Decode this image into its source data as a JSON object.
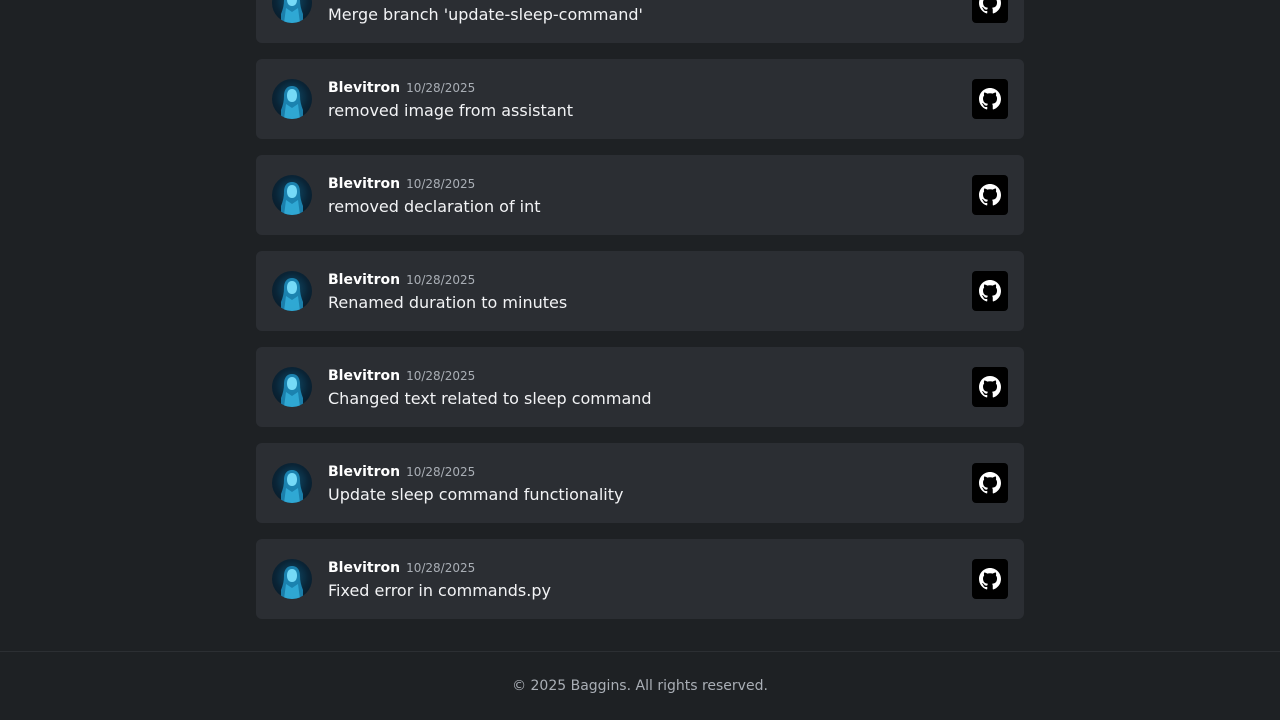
{
  "commits": [
    {
      "author": "",
      "date": "",
      "message": "Merge branch 'update-sleep-command'",
      "link_icon": "github-icon"
    },
    {
      "author": "Blevitron",
      "date": "10/28/2025",
      "message": "removed image from assistant",
      "link_icon": "github-icon"
    },
    {
      "author": "Blevitron",
      "date": "10/28/2025",
      "message": "removed declaration of int",
      "link_icon": "github-icon"
    },
    {
      "author": "Blevitron",
      "date": "10/28/2025",
      "message": "Renamed duration to minutes",
      "link_icon": "github-icon"
    },
    {
      "author": "Blevitron",
      "date": "10/28/2025",
      "message": "Changed text related to sleep command",
      "link_icon": "github-icon"
    },
    {
      "author": "Blevitron",
      "date": "10/28/2025",
      "message": "Update sleep command functionality",
      "link_icon": "github-icon"
    },
    {
      "author": "Blevitron",
      "date": "10/28/2025",
      "message": "Fixed error in commands.py",
      "link_icon": "github-icon"
    }
  ],
  "footer": {
    "text": "© 2025 Baggins. All rights reserved."
  },
  "colors": {
    "background": "#1e2124",
    "card": "#2b2e33",
    "muted_text": "#a9aeb5",
    "github_button": "#000000"
  }
}
